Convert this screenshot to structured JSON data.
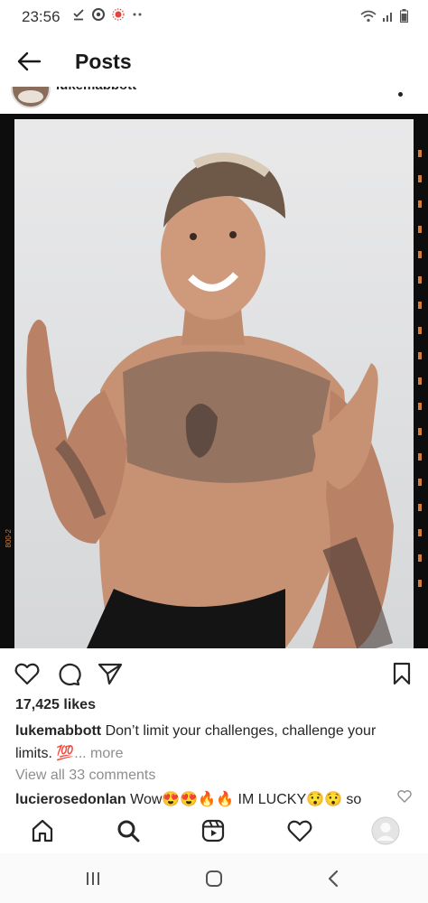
{
  "status_bar": {
    "time": "23:56"
  },
  "app_bar": {
    "title": "Posts"
  },
  "post": {
    "username": "lukemabbott",
    "film_label": "800-2",
    "likes": "17,425 likes",
    "caption_user": "lukemabbott",
    "caption_text": " Don’t limit your challenges, challenge your limits. 💯",
    "caption_more": "... more",
    "view_comments": "View all 33 comments",
    "comment_user": "lucierosedonlan",
    "comment_text": " Wow😍😍🔥🔥 IM LUCKY😯😯 so"
  },
  "colors": {
    "text": "#262626",
    "muted": "#8e8e8e",
    "film_accent": "#d57b3a"
  }
}
